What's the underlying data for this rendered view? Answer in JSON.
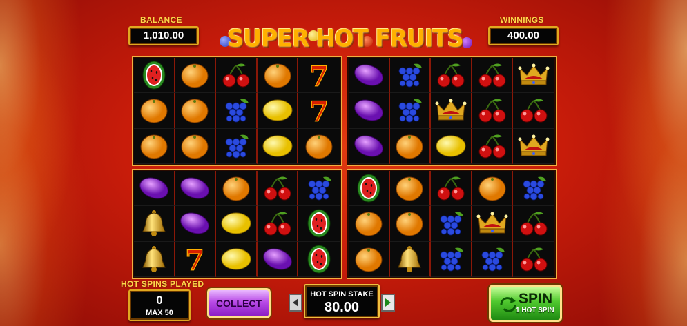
{
  "balance": {
    "label": "BALANCE",
    "value": "1,010.00"
  },
  "winnings": {
    "label": "WINNINGS",
    "value": "400.00"
  },
  "logo": {
    "title": "SUPER HOT FRUITS"
  },
  "reels": {
    "top_left": [
      [
        "watermelon",
        "orange",
        "cherry",
        "orange",
        "seven"
      ],
      [
        "orange",
        "orange",
        "grapes",
        "lemon",
        "seven"
      ],
      [
        "orange",
        "orange",
        "grapes",
        "lemon",
        "orange"
      ]
    ],
    "top_right": [
      [
        "plum",
        "grapes",
        "cherry",
        "cherry",
        "crown"
      ],
      [
        "plum",
        "grapes",
        "crown",
        "cherry",
        "cherry"
      ],
      [
        "plum",
        "orange",
        "lemon",
        "cherry",
        "crown"
      ]
    ],
    "bottom_left": [
      [
        "plum",
        "plum",
        "orange",
        "cherry",
        "grapes"
      ],
      [
        "bell",
        "plum",
        "lemon",
        "cherry",
        "watermelon"
      ],
      [
        "bell",
        "seven",
        "lemon",
        "plum",
        "watermelon"
      ]
    ],
    "bottom_right": [
      [
        "watermelon",
        "orange",
        "cherry",
        "orange",
        "grapes"
      ],
      [
        "orange",
        "orange",
        "grapes",
        "crown",
        "cherry"
      ],
      [
        "orange",
        "bell",
        "grapes",
        "grapes",
        "cherry"
      ]
    ]
  },
  "hot_spins": {
    "label": "HOT SPINS PLAYED",
    "count": "0",
    "max": "MAX 50"
  },
  "collect": {
    "label": "COLLECT"
  },
  "stake": {
    "label": "HOT SPIN STAKE",
    "value": "80.00"
  },
  "spin": {
    "label": "SPIN",
    "sublabel": "1 HOT SPIN"
  },
  "colors": {
    "gold": "#ffd54a",
    "background": "#c81c0a",
    "collect": "#b84ae6",
    "spin": "#4fc82e"
  }
}
